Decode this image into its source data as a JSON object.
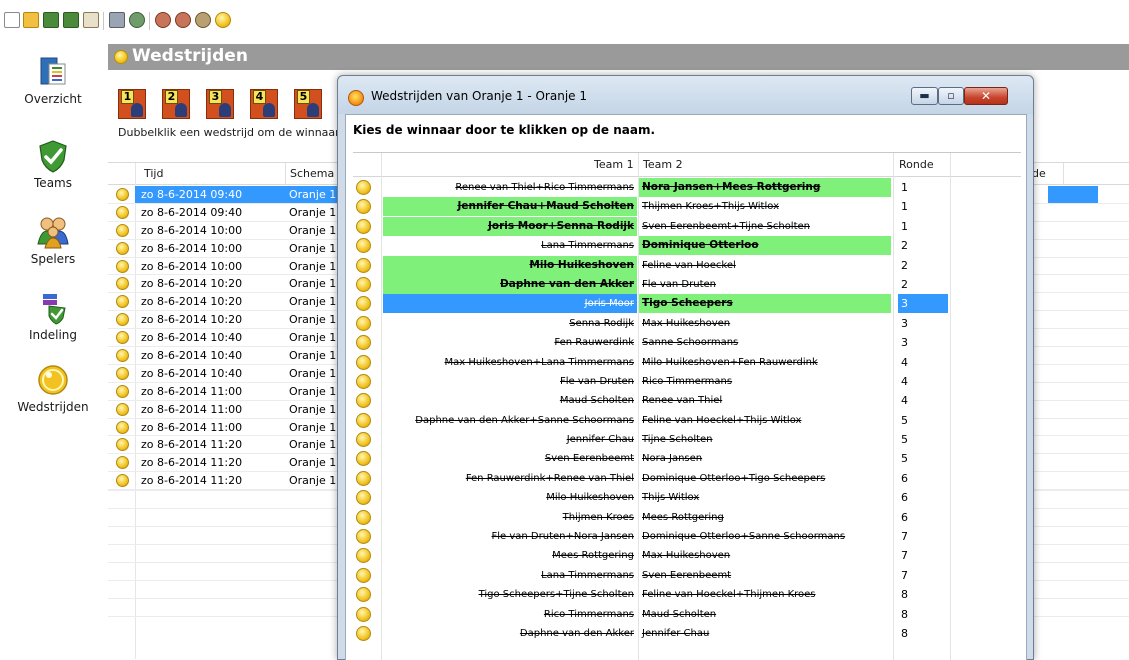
{
  "toolbar": {
    "icons": [
      "new-document-icon",
      "open-folder-icon",
      "save-icon",
      "save-as-icon",
      "import-icon",
      "print-icon",
      "print-preview-icon",
      "users-icon",
      "users-alt-icon",
      "settings-icon",
      "wedstrijd-ball-icon"
    ]
  },
  "nav": {
    "items": [
      {
        "label": "Overzicht",
        "icon": "overview-icon"
      },
      {
        "label": "Teams",
        "icon": "shield-icon"
      },
      {
        "label": "Spelers",
        "icon": "players-icon"
      },
      {
        "label": "Indeling",
        "icon": "layout-icon"
      },
      {
        "label": "Wedstrijden",
        "icon": "ball-icon"
      }
    ]
  },
  "main": {
    "title": "Wedstrijden",
    "schema_buttons": [
      "1",
      "2",
      "3",
      "4",
      "5"
    ],
    "hint": "Dubbelklik een wedstrijd om de winnaar",
    "columns": {
      "tijd": "Tijd",
      "schema": "Schema",
      "ronde_fragment": "de"
    },
    "rows": [
      {
        "tijd": "zo 8-6-2014 09:40",
        "schema": "Oranje 1",
        "selected": true
      },
      {
        "tijd": "zo 8-6-2014 09:40",
        "schema": "Oranje 1"
      },
      {
        "tijd": "zo 8-6-2014 10:00",
        "schema": "Oranje 1"
      },
      {
        "tijd": "zo 8-6-2014 10:00",
        "schema": "Oranje 1"
      },
      {
        "tijd": "zo 8-6-2014 10:00",
        "schema": "Oranje 1"
      },
      {
        "tijd": "zo 8-6-2014 10:20",
        "schema": "Oranje 1"
      },
      {
        "tijd": "zo 8-6-2014 10:20",
        "schema": "Oranje 1"
      },
      {
        "tijd": "zo 8-6-2014 10:20",
        "schema": "Oranje 1"
      },
      {
        "tijd": "zo 8-6-2014 10:40",
        "schema": "Oranje 1"
      },
      {
        "tijd": "zo 8-6-2014 10:40",
        "schema": "Oranje 1"
      },
      {
        "tijd": "zo 8-6-2014 10:40",
        "schema": "Oranje 1"
      },
      {
        "tijd": "zo 8-6-2014 11:00",
        "schema": "Oranje 1"
      },
      {
        "tijd": "zo 8-6-2014 11:00",
        "schema": "Oranje 1"
      },
      {
        "tijd": "zo 8-6-2014 11:00",
        "schema": "Oranje 1"
      },
      {
        "tijd": "zo 8-6-2014 11:20",
        "schema": "Oranje 1"
      },
      {
        "tijd": "zo 8-6-2014 11:20",
        "schema": "Oranje 1"
      },
      {
        "tijd": "zo 8-6-2014 11:20",
        "schema": "Oranje 1"
      }
    ]
  },
  "dialog": {
    "title": "Wedstrijden van Oranje 1 - Oranje 1",
    "instruction": "Kies de winnaar door te klikken op de naam.",
    "buttons": {
      "minimize": "▬",
      "maximize": "▫",
      "close": "✕"
    },
    "columns": {
      "team1": "Team 1",
      "team2": "Team 2",
      "ronde": "Ronde"
    },
    "matches": [
      {
        "team1": "Renee van Thiel+Rico Timmermans",
        "team2": "Nora Jansen+Mees Rottgering",
        "ronde": "1",
        "winner": 2
      },
      {
        "team1": "Jennifer Chau+Maud Scholten",
        "team2": "Thijmen Kroes+Thijs Witlox",
        "ronde": "1",
        "winner": 1
      },
      {
        "team1": "Joris Moor+Senna Rodijk",
        "team2": "Sven Eerenbeemt+Tijne Scholten",
        "ronde": "1",
        "winner": 1
      },
      {
        "team1": "Lana Timmermans",
        "team2": "Dominique Otterloo",
        "ronde": "2",
        "winner": 2
      },
      {
        "team1": "Milo Huikeshoven",
        "team2": "Feline van Hoeckel",
        "ronde": "2",
        "winner": 1
      },
      {
        "team1": "Daphne van den Akker",
        "team2": "Fle van Druten",
        "ronde": "2",
        "winner": 1
      },
      {
        "team1": "Joris Moor",
        "team2": "Tigo Scheepers",
        "ronde": "3",
        "winner": 2,
        "selected": true
      },
      {
        "team1": "Senna Rodijk",
        "team2": "Max Huikeshoven",
        "ronde": "3",
        "winner": 0
      },
      {
        "team1": "Fen Rauwerdink",
        "team2": "Sanne Schoormans",
        "ronde": "3",
        "winner": 0
      },
      {
        "team1": "Max Huikeshoven+Lana Timmermans",
        "team2": "Milo Huikeshoven+Fen Rauwerdink",
        "ronde": "4",
        "winner": 0
      },
      {
        "team1": "Fle van Druten",
        "team2": "Rico Timmermans",
        "ronde": "4",
        "winner": 0
      },
      {
        "team1": "Maud Scholten",
        "team2": "Renee van Thiel",
        "ronde": "4",
        "winner": 0
      },
      {
        "team1": "Daphne van den Akker+Sanne Schoormans",
        "team2": "Feline van Hoeckel+Thijs Witlox",
        "ronde": "5",
        "winner": 0
      },
      {
        "team1": "Jennifer Chau",
        "team2": "Tijne Scholten",
        "ronde": "5",
        "winner": 0
      },
      {
        "team1": "Sven Eerenbeemt",
        "team2": "Nora Jansen",
        "ronde": "5",
        "winner": 0
      },
      {
        "team1": "Fen Rauwerdink+Renee van Thiel",
        "team2": "Dominique Otterloo+Tigo Scheepers",
        "ronde": "6",
        "winner": 0
      },
      {
        "team1": "Milo Huikeshoven",
        "team2": "Thijs Witlox",
        "ronde": "6",
        "winner": 0
      },
      {
        "team1": "Thijmen Kroes",
        "team2": "Mees Rottgering",
        "ronde": "6",
        "winner": 0
      },
      {
        "team1": "Fle van Druten+Nora Jansen",
        "team2": "Dominique Otterloo+Sanne Schoormans",
        "ronde": "7",
        "winner": 0
      },
      {
        "team1": "Mees Rottgering",
        "team2": "Max Huikeshoven",
        "ronde": "7",
        "winner": 0
      },
      {
        "team1": "Lana Timmermans",
        "team2": "Sven Eerenbeemt",
        "ronde": "7",
        "winner": 0
      },
      {
        "team1": "Tigo Scheepers+Tijne Scholten",
        "team2": "Feline van Hoeckel+Thijmen Kroes",
        "ronde": "8",
        "winner": 0
      },
      {
        "team1": "Rico Timmermans",
        "team2": "Maud Scholten",
        "ronde": "8",
        "winner": 0
      },
      {
        "team1": "Daphne van den Akker",
        "team2": "Jennifer Chau",
        "ronde": "8",
        "winner": 0
      }
    ]
  },
  "colors": {
    "selection": "#3399ff",
    "winner": "#7ff07a",
    "header_bar": "#9a9a9a",
    "ball": "#f2c320"
  }
}
